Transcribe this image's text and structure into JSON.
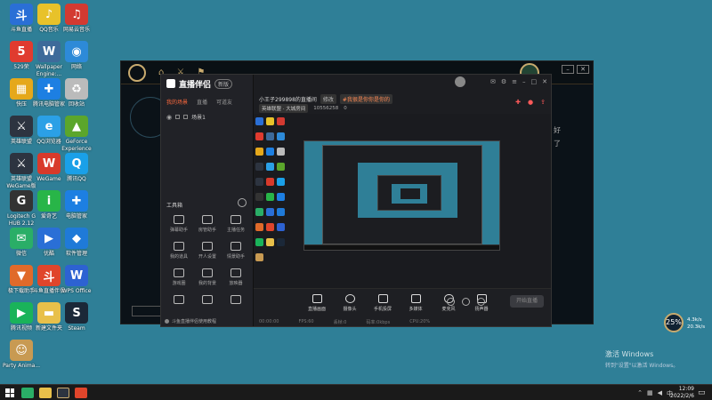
{
  "desktop": {
    "icons": [
      {
        "label": "斗鱼直播",
        "glyph": "斗",
        "color": "#2a6fd6"
      },
      {
        "label": "QQ音乐",
        "glyph": "♪",
        "color": "#e8c22a"
      },
      {
        "label": "网易云音乐",
        "glyph": "♫",
        "color": "#d33a31"
      },
      {
        "label": "529荣",
        "glyph": "5",
        "color": "#e03b2f"
      },
      {
        "label": "Wallpaper Engine:...",
        "glyph": "W",
        "color": "#3d6a9a"
      },
      {
        "label": "网络",
        "glyph": "◉",
        "color": "#2d8ad8"
      },
      {
        "label": "快压",
        "glyph": "▦",
        "color": "#e5a81b"
      },
      {
        "label": "腾讯电脑管家",
        "glyph": "✚",
        "color": "#1d7fe2"
      },
      {
        "label": "回收站",
        "glyph": "♻",
        "color": "#bbbbbb"
      },
      {
        "label": "英雄联盟",
        "glyph": "⚔",
        "color": "#2d3440"
      },
      {
        "label": "QQ浏览器",
        "glyph": "e",
        "color": "#2ba0e6"
      },
      {
        "label": "GeForce Experience",
        "glyph": "▲",
        "color": "#5ba62b"
      },
      {
        "label": "英雄联盟 WeGame版",
        "glyph": "⚔",
        "color": "#2d3440"
      },
      {
        "label": "WeGame",
        "glyph": "W",
        "color": "#d83a2b"
      },
      {
        "label": "腾讯QQ",
        "glyph": "Q",
        "color": "#1aa0e8"
      },
      {
        "label": "Logitech G HUB 2.12",
        "glyph": "G",
        "color": "#333333"
      },
      {
        "label": "爱奇艺",
        "glyph": "i",
        "color": "#28b548"
      },
      {
        "label": "电脑管家",
        "glyph": "✚",
        "color": "#1d7fe2"
      },
      {
        "label": "微信",
        "glyph": "✉",
        "color": "#2aae67"
      },
      {
        "label": "优酷",
        "glyph": "▶",
        "color": "#2a6fd6"
      },
      {
        "label": "软件管理",
        "glyph": "◆",
        "color": "#1f7ad8"
      },
      {
        "label": "极下载助手",
        "glyph": "▼",
        "color": "#e06a2a"
      },
      {
        "label": "斗鱼直播伴侣",
        "glyph": "斗",
        "color": "#e0452b"
      },
      {
        "label": "WPS Office",
        "glyph": "W",
        "color": "#2d62d2"
      },
      {
        "label": "腾讯视频",
        "glyph": "▶",
        "color": "#1ab35a"
      },
      {
        "label": "新建文件夹",
        "glyph": "▬",
        "color": "#e8c04a"
      },
      {
        "label": "Steam",
        "glyph": "S",
        "color": "#1b2838"
      },
      {
        "label": "Party Anima...",
        "glyph": "☺",
        "color": "#c89a52"
      }
    ]
  },
  "game": {
    "right_items": [
      "好",
      "",
      "",
      "",
      "",
      "",
      "了",
      "",
      "",
      "",
      "",
      "",
      "",
      "",
      ""
    ]
  },
  "app": {
    "brand": "直播伴侣",
    "version": "新版",
    "tabs": [
      "我的场景",
      "直播",
      "可道友"
    ],
    "scene_name": "场景1",
    "room_title": "小王子299898的直播间",
    "room_tag1": "修改",
    "room_tag2": "#我很是你你是你的",
    "category": "英雄联盟 · 大城房间",
    "room_id": "10556258",
    "room_followers": "0",
    "toolbox_title": "工具箱",
    "tools": [
      "弹幕助手",
      "房管助手",
      "主播任务",
      "我的道具",
      "开人设置",
      "情景助手",
      "游戏圈",
      "我的背景",
      "放映器",
      "",
      "",
      ""
    ],
    "tip": "斗鱼直播伴侣使用教程",
    "bottom_buttons": [
      "直播画面",
      "摄像头",
      "手机投屏",
      "多媒体",
      "麦克风",
      "扬声器"
    ],
    "start_label": "开始直播",
    "status": [
      "00:00:00",
      "FPS:60",
      "丢帧:0",
      "码率:0kbps",
      "CPU:20%"
    ]
  },
  "overlay": {
    "percent": "25%",
    "up": "4.3k/s",
    "down": "20.3k/s"
  },
  "activate": {
    "title": "激活 Windows",
    "sub": "转到\"设置\"以激活 Windows。"
  },
  "taskbar": {
    "time": "12:09",
    "date": "2022/2/6"
  }
}
